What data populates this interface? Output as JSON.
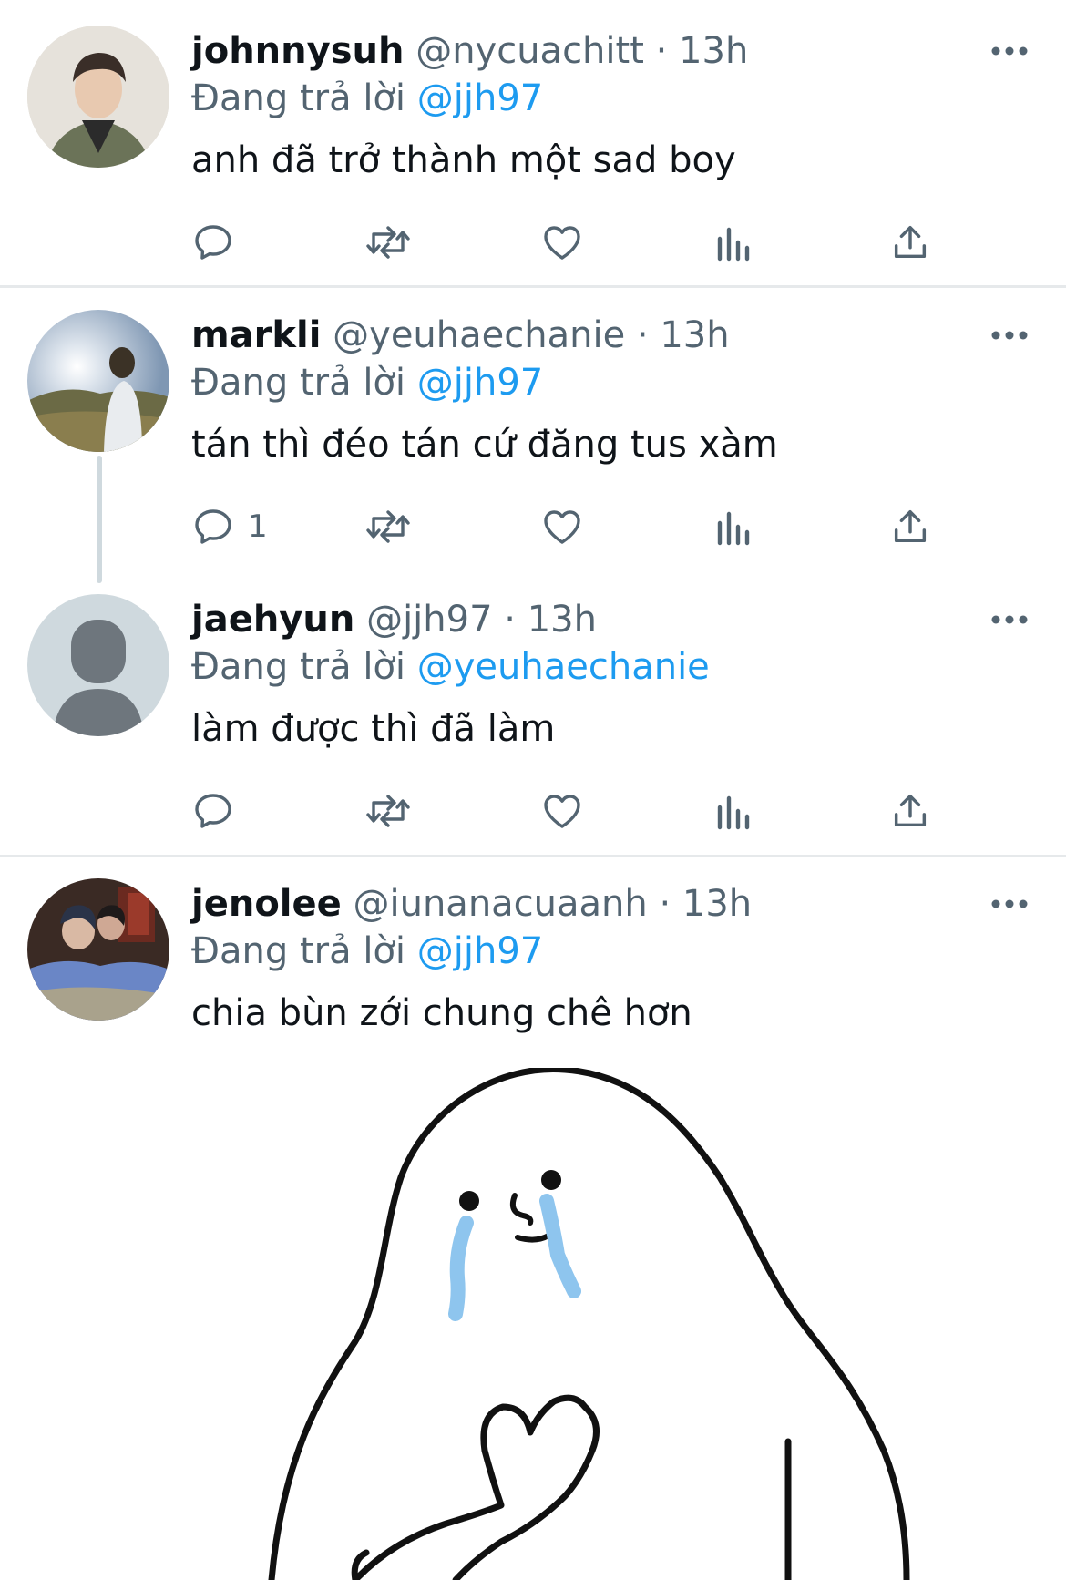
{
  "tweets": [
    {
      "name": "johnnysuh",
      "handle": "@nycuachitt",
      "time": "· 13h",
      "reply_prefix": "Đang trả lời",
      "reply_to": "@jjh97",
      "text": "anh đã trở thành một sad boy",
      "reply_count": ""
    },
    {
      "name": "markli",
      "handle": "@yeuhaechanie",
      "time": "· 13h",
      "reply_prefix": "Đang trả lời",
      "reply_to": "@jjh97",
      "text": "tán thì đéo tán cứ đăng tus xàm",
      "reply_count": "1"
    },
    {
      "name": "jaehyun",
      "handle": "@jjh97",
      "time": "· 13h",
      "reply_prefix": "Đang trả lời",
      "reply_to": "@yeuhaechanie",
      "text": "làm được thì đã làm",
      "reply_count": ""
    },
    {
      "name": "jenolee",
      "handle": "@iunanacuaanh",
      "time": "· 13h",
      "reply_prefix": "Đang trả lời",
      "reply_to": "@jjh97",
      "text": "chia bùn zới chung chê hơn",
      "reply_count": ""
    }
  ],
  "icons": {
    "more": "more-horizontal-icon",
    "reply": "reply-bubble-icon",
    "retweet": "retweet-icon",
    "like": "heart-icon",
    "views": "bar-chart-icon",
    "share": "share-upload-icon"
  },
  "colors": {
    "text": "#0f1419",
    "secondary": "#536471",
    "mention": "#1d9bf0",
    "divider": "#e6e9eb",
    "tear": "#8ec5ee"
  },
  "media": {
    "description_icon": "crying-ghost-sticker"
  }
}
